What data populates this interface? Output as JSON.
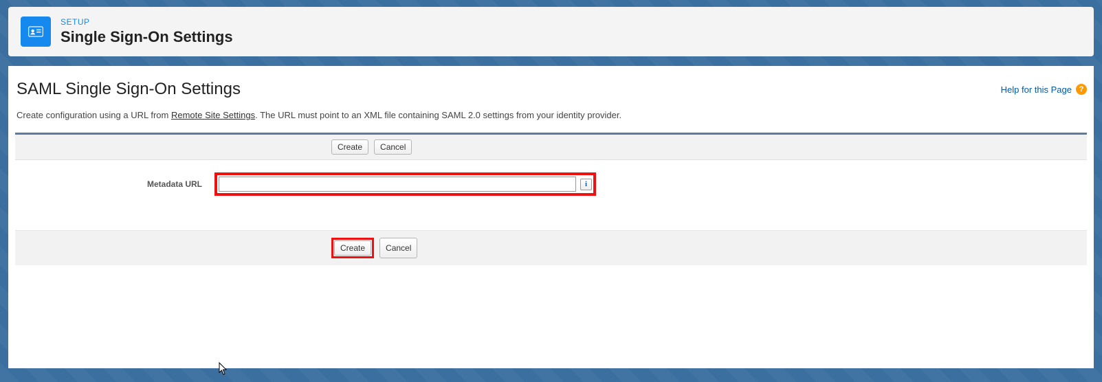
{
  "header": {
    "eyebrow": "SETUP",
    "title": "Single Sign-On Settings"
  },
  "content": {
    "title": "SAML Single Sign-On Settings",
    "help_label": "Help for this Page",
    "desc_prefix": "Create configuration using a URL from ",
    "desc_link": "Remote Site Settings",
    "desc_suffix": ". The URL must point to an XML file containing SAML 2.0 settings from your identity provider."
  },
  "form": {
    "buttons": {
      "create": "Create",
      "cancel": "Cancel"
    },
    "field_label": "Metadata URL",
    "field_value": "",
    "info_symbol": "i"
  }
}
